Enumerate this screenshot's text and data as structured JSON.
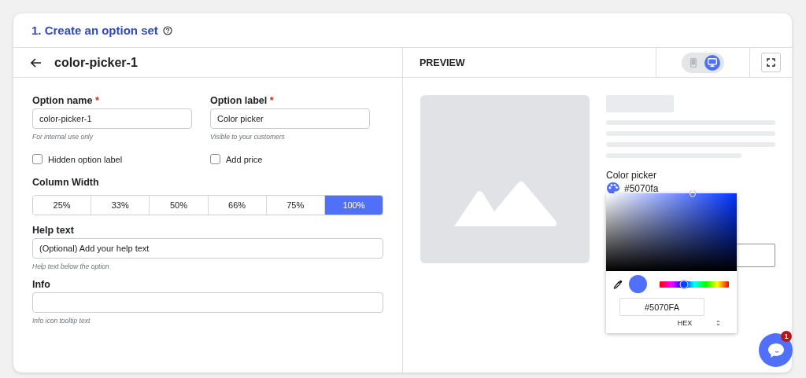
{
  "header": {
    "title": "1. Create an option set"
  },
  "editor": {
    "title": "color-picker-1",
    "name_field": {
      "label": "Option name",
      "required_mark": "*",
      "value": "color-picker-1",
      "hint": "For internal use only"
    },
    "label_field": {
      "label": "Option label",
      "required_mark": "*",
      "value": "Color picker",
      "hint": "Visible to your customers"
    },
    "checkboxes": [
      {
        "label": "Hidden option label",
        "checked": false
      },
      {
        "label": "Add price",
        "checked": false
      }
    ],
    "column_width": {
      "label": "Column Width",
      "options": [
        {
          "label": "25%",
          "selected": false
        },
        {
          "label": "33%",
          "selected": false
        },
        {
          "label": "50%",
          "selected": false
        },
        {
          "label": "66%",
          "selected": false
        },
        {
          "label": "75%",
          "selected": false
        },
        {
          "label": "100%",
          "selected": true
        }
      ]
    },
    "help_field": {
      "label": "Help text",
      "placeholder": "(Optional) Add your help text",
      "hint": "Help text below the option"
    },
    "info_field": {
      "label": "Info",
      "hint": "Info icon tooltip text"
    }
  },
  "preview": {
    "title": "PREVIEW",
    "devices": [
      {
        "kind": "mobile",
        "selected": false
      },
      {
        "kind": "desktop",
        "selected": true
      }
    ],
    "option_label": "Color picker",
    "color_value": "#5070fa",
    "picker": {
      "swatch": {
        "color": "#5070fa"
      },
      "hue": {
        "level": 0.35
      },
      "hex": "#5070FA",
      "format": "HEX"
    }
  },
  "chat": {
    "badge": "1"
  }
}
